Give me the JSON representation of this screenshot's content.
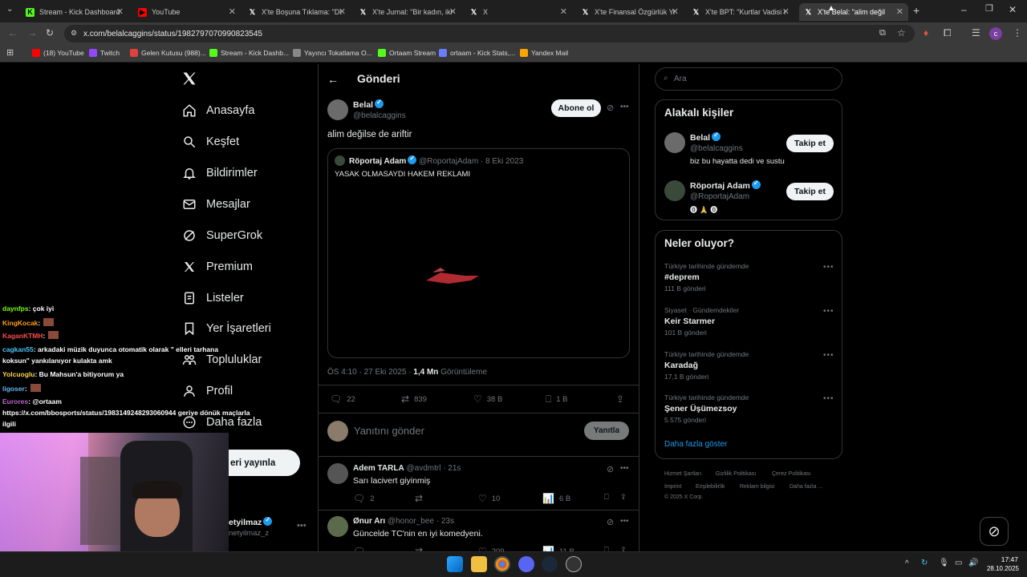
{
  "browser": {
    "tabs": [
      {
        "title": "Stream - Kick Dashboard",
        "icon": "kick-icon",
        "color": "#53fc18"
      },
      {
        "title": "YouTube",
        "icon": "youtube-icon",
        "color": "#ff0000"
      },
      {
        "title": "X'te Boşuna Tıklama: \"Dü",
        "icon": "x-icon",
        "color": "#ffffff"
      },
      {
        "title": "X'te Jurnal: \"Bir kadın, iki",
        "icon": "x-icon",
        "color": "#ffffff"
      },
      {
        "title": "X",
        "icon": "x-icon",
        "color": "#ffffff"
      },
      {
        "title": "X'te Finansal Özgürlük Yo",
        "icon": "x-icon",
        "color": "#ffffff"
      },
      {
        "title": "X'te BPT: \"Kurtlar Vadisi d",
        "icon": "x-icon",
        "color": "#ffffff"
      },
      {
        "title": "X'te Belal: \"alim değil",
        "icon": "x-icon",
        "color": "#ffffff",
        "active": true
      }
    ],
    "url": "x.com/belalcaggins/status/1982797070990823545",
    "bookmarks": [
      {
        "label": "(18) YouTube",
        "color": "#ff0000"
      },
      {
        "label": "Twitch",
        "color": "#9146ff"
      },
      {
        "label": "Gelen Kutusu (988)...",
        "color": "#e04040"
      },
      {
        "label": "Stream - Kick Dashb...",
        "color": "#53fc18"
      },
      {
        "label": "Yayıncı Tokatlama O...",
        "color": "#888888"
      },
      {
        "label": "Ortaam Stream",
        "color": "#53fc18"
      },
      {
        "label": "ortaam - Kick Stats,...",
        "color": "#6a7cff"
      },
      {
        "label": "Yandex Mail",
        "color": "#ffa500"
      }
    ],
    "profile_initial": "c"
  },
  "nav": {
    "items": [
      {
        "label": "Anasayfa",
        "icon": "home-icon"
      },
      {
        "label": "Keşfet",
        "icon": "search-icon"
      },
      {
        "label": "Bildirimler",
        "icon": "bell-icon"
      },
      {
        "label": "Mesajlar",
        "icon": "mail-icon"
      },
      {
        "label": "SuperGrok",
        "icon": "grok-icon"
      },
      {
        "label": "Premium",
        "icon": "x-logo-icon"
      },
      {
        "label": "Listeler",
        "icon": "list-icon"
      },
      {
        "label": "Yer İşaretleri",
        "icon": "bookmark-icon"
      },
      {
        "label": "Topluluklar",
        "icon": "people-icon"
      },
      {
        "label": "Profil",
        "icon": "user-icon"
      },
      {
        "label": "Daha fazla",
        "icon": "more-icon"
      }
    ],
    "post_button": "eri yayınla",
    "account_name": "etyilmaz",
    "account_handle": "netyilmaz_z"
  },
  "post": {
    "header": "Gönderi",
    "author_name": "Belal",
    "author_handle": "@belalcaggins",
    "follow_button": "Abone ol",
    "text": "alim değilse de ariftir",
    "quote": {
      "author_name": "Röportaj Adam",
      "author_handle": "@RoportajAdam",
      "date": "· 8 Eki 2023",
      "text": "YASAK OLMASAYDI HAKEM REKLAMI"
    },
    "timestamp": "ÖS 4:10 · 27 Eki 2025 ·",
    "views_count": "1,4 Mn",
    "views_label": "Görüntüleme",
    "replies": "22",
    "reposts": "839",
    "likes": "38 B",
    "bookmarks": "1 B",
    "reply_placeholder": "Yanıtını gönder",
    "reply_button": "Yanıtla"
  },
  "replies": [
    {
      "name": "Adem TARLA",
      "handle": "@avdmtrl",
      "time": "· 21s",
      "text": "Sarı lacivert giyinmiş",
      "replies": "2",
      "reposts": "",
      "likes": "10",
      "views": "6 B"
    },
    {
      "name": "Ønur Arı",
      "handle": "@honor_bee",
      "time": "· 23s",
      "text": "Güncelde TC'nin en iyi komedyeni.",
      "replies": "",
      "reposts": "",
      "likes": "209",
      "views": "11 B"
    }
  ],
  "search": {
    "placeholder": "Ara"
  },
  "related": {
    "title": "Alakalı kişiler",
    "people": [
      {
        "name": "Belal",
        "handle": "@belalcaggins",
        "bio": "biz bu hayatta dedi ve sustu",
        "button": "Takip et"
      },
      {
        "name": "Röportaj Adam",
        "handle": "@RoportajAdam",
        "bio": "",
        "button": "Takip et"
      }
    ]
  },
  "trends": {
    "title": "Neler oluyor?",
    "items": [
      {
        "category": "Türkiye tarihinde gündemde",
        "name": "#deprem",
        "count": "111 B gönderi"
      },
      {
        "category": "Siyaset · Gündemdekiler",
        "name": "Keir Starmer",
        "count": "101 B gönderi"
      },
      {
        "category": "Türkiye tarihinde gündemde",
        "name": "Karadağ",
        "count": "17,1 B gönderi"
      },
      {
        "category": "Türkiye tarihinde gündemde",
        "name": "Şener Üşümezsoy",
        "count": "5.575 gönderi"
      }
    ],
    "show_more": "Daha fazla göster"
  },
  "footer": {
    "links": [
      "Hizmet Şartları",
      "Gizlilik Politikası",
      "Çerez Politikası",
      "Imprint",
      "Erişilebilirlik",
      "Reklam bilgisi",
      "Daha fazla ..."
    ],
    "copyright": "© 2025 X Corp."
  },
  "chat": [
    {
      "user": "daynfps",
      "msg": ": çok iyi",
      "color": "#7cfc00"
    },
    {
      "user": "KingKocak",
      "msg": ":",
      "color": "#ff9f1a"
    },
    {
      "user": "KaganKTMH",
      "msg": ":",
      "color": "#ff4d4d"
    },
    {
      "user": "cagkan55",
      "msg": ": arkadaki müzik duyunca otomatik olarak \" elleri tarhana",
      "color": "#4fc3f7"
    },
    {
      "user": "",
      "msg": "koksun\" yankılanıyor kulakta amk",
      "color": "#ffffff"
    },
    {
      "user": "Yolcuoglu",
      "msg": ": Bu Mahsun'a bitiyorum ya",
      "color": "#ffd54f"
    },
    {
      "user": "ligoser",
      "msg": ":",
      "color": "#64b5f6"
    },
    {
      "user": "Eurores",
      "msg": ": @ortaam",
      "color": "#ba68c8"
    },
    {
      "user": "",
      "msg": "https://x.com/bbosports/status/1983149248293060944 geriye dönük maçlarla",
      "color": "#ffffff"
    },
    {
      "user": "",
      "msg": "ilgili",
      "color": "#ffffff"
    }
  ],
  "clock": {
    "time": "17:47",
    "date": "28.10.2025"
  },
  "colors": {
    "accent": "#1d9bf0",
    "background": "#000000",
    "border": "#2f3336",
    "muted": "#71767b"
  }
}
